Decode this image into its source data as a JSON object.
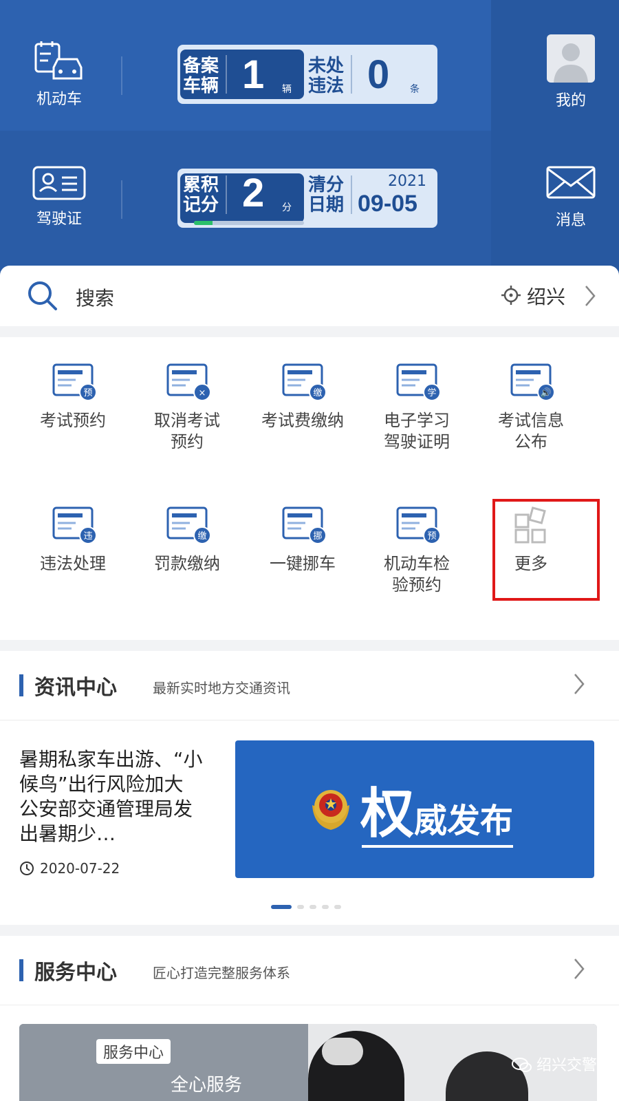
{
  "header": {
    "vehicle_label": "机动车",
    "license_label": "驾驶证",
    "mine_label": "我的",
    "message_label": "消息",
    "vehicles_panel": {
      "reg_label_1": "备案",
      "reg_label_2": "车辆",
      "reg_value": "1",
      "reg_unit": "辆",
      "vio_label_1": "未处",
      "vio_label_2": "违法",
      "vio_value": "0",
      "vio_unit": "条"
    },
    "points_panel": {
      "pts_label_1": "累积",
      "pts_label_2": "记分",
      "pts_value": "2",
      "pts_unit": "分",
      "clear_label_1": "清分",
      "clear_label_2": "日期",
      "clear_year": "2021",
      "clear_date": "09-05",
      "progress_fraction": 0.17
    }
  },
  "search": {
    "placeholder": "搜索",
    "city": "绍兴"
  },
  "services": [
    {
      "line1": "考试预约",
      "line2": "",
      "icon": "exam-booking-icon",
      "badge": "预"
    },
    {
      "line1": "取消考试",
      "line2": "预约",
      "icon": "cancel-exam-icon",
      "badge": "×"
    },
    {
      "line1": "考试费缴纳",
      "line2": "",
      "icon": "exam-fee-icon",
      "badge": "缴"
    },
    {
      "line1": "电子学习",
      "line2": "驾驶证明",
      "icon": "study-certificate-icon",
      "badge": "学"
    },
    {
      "line1": "考试信息",
      "line2": "公布",
      "icon": "exam-info-icon",
      "badge": "🔊"
    },
    {
      "line1": "违法处理",
      "line2": "",
      "icon": "violation-icon",
      "badge": "违"
    },
    {
      "line1": "罚款缴纳",
      "line2": "",
      "icon": "fine-payment-icon",
      "badge": "缴"
    },
    {
      "line1": "一键挪车",
      "line2": "",
      "icon": "move-car-icon",
      "badge": "挪"
    },
    {
      "line1": "机动车检",
      "line2": "验预约",
      "icon": "inspection-booking-icon",
      "badge": "预"
    },
    {
      "line1": "更多",
      "line2": "",
      "icon": "more-icon",
      "badge": ""
    }
  ],
  "news": {
    "title": "资讯中心",
    "subtitle": "最新实时地方交通资讯",
    "article_text": "暑期私家车出游、“小候鸟”出行风险加大 公安部交通管理局发出暑期少…",
    "article_date": "2020-07-22",
    "banner_big": "权",
    "banner_rest": "威发布",
    "pager_count": 5,
    "pager_active": 0
  },
  "service_center": {
    "title": "服务中心",
    "subtitle": "匠心打造完整服务体系",
    "photo_tag": "服务中心",
    "photo_caption": "全心服务",
    "watermark": "绍兴交警"
  },
  "colors": {
    "header_blue": "#2d62b0",
    "panel_navy": "#1f4e93",
    "highlight_red": "#e01818",
    "progress_green": "#2bbf6a"
  }
}
